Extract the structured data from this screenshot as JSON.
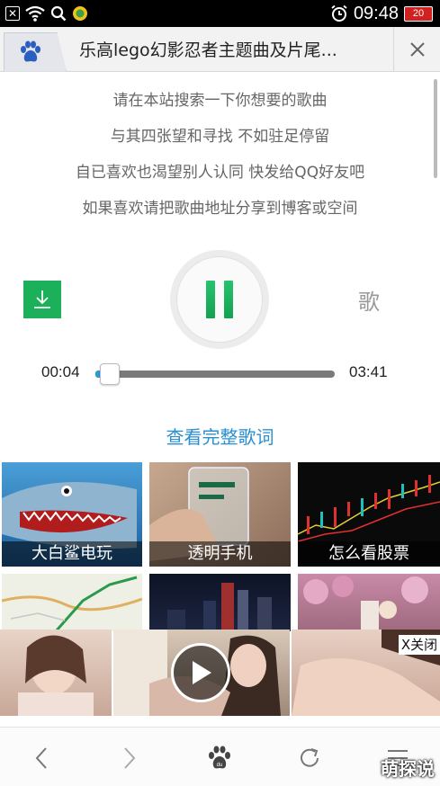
{
  "status_bar": {
    "time": "09:48",
    "battery": "20",
    "notification_icons": [
      "close-box-icon",
      "wifi-icon",
      "search-icon",
      "app-badge-icon"
    ],
    "alarm_icon": "alarm-clock-icon"
  },
  "browser": {
    "tab_icon": "baidu-paw-icon",
    "title": "乐高lego幻影忍者主题曲及片尾...",
    "close_icon": "close-icon"
  },
  "lyrics": [
    "请在本站搜索一下你想要的歌曲",
    "与其四张望和寻找 不如驻足停留",
    "自已喜欢也渴望别人认同 快发给QQ好友吧",
    "如果喜欢请把歌曲地址分享到博客或空间"
  ],
  "player": {
    "download_icon": "download-icon",
    "state": "playing",
    "lyrics_button": "歌",
    "current_time": "00:04",
    "total_time": "03:41",
    "progress": 0.018,
    "accent_color": "#1db05a"
  },
  "full_lyrics_link": "查看完整歌词",
  "thumbnails": [
    {
      "label": "大白鲨电玩"
    },
    {
      "label": "透明手机"
    },
    {
      "label": "怎么看股票"
    },
    {
      "label": ""
    },
    {
      "label": ""
    },
    {
      "label": ""
    }
  ],
  "ad": {
    "close_label": "X关闭",
    "play_icon": "play-icon"
  },
  "bottom_nav": {
    "items": [
      "back-icon",
      "forward-icon",
      "baidu-home-icon",
      "refresh-icon",
      "menu-icon"
    ]
  },
  "watermark": "萌探说"
}
